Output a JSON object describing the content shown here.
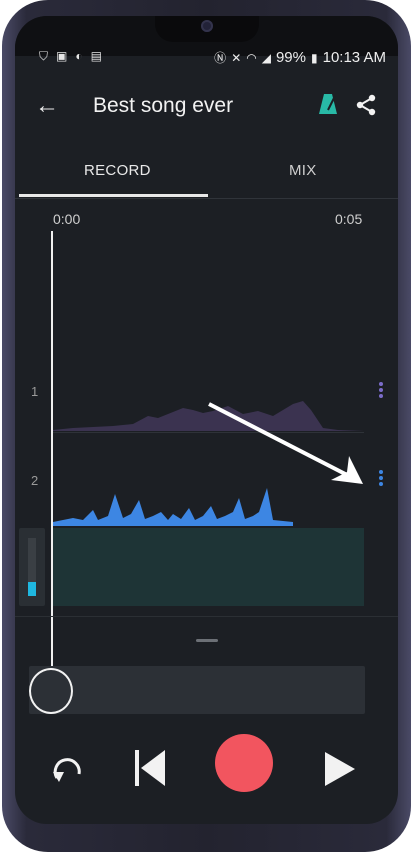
{
  "status_bar": {
    "battery": "99%",
    "time": "10:13 AM",
    "left_icons": [
      "shield-icon",
      "image-icon",
      "sync-icon",
      "file-icon"
    ],
    "right_icons": [
      "nfc-icon",
      "mute-icon",
      "wifi-icon",
      "signal-icon",
      "battery-icon"
    ]
  },
  "app_bar": {
    "title": "Best song ever",
    "back_icon": "arrow-left-icon",
    "metronome_icon": "metronome-icon",
    "share_icon": "share-icon",
    "accent": "#28b9a6"
  },
  "tabs": [
    {
      "label": "RECORD",
      "active": true
    },
    {
      "label": "MIX",
      "active": false
    }
  ],
  "timeline": {
    "start": "0:00",
    "end": "0:05"
  },
  "tracks": [
    {
      "number": "1",
      "color": "#3b3350",
      "menu_color": "#7b6cc9"
    },
    {
      "number": "2",
      "color": "#3d86e3",
      "menu_color": "#3d86e3"
    }
  ],
  "input_level": 0.25,
  "controls": {
    "undo_icon": "undo-icon",
    "rewind_icon": "skip-previous-icon",
    "record_icon": "record-icon",
    "play_icon": "play-icon",
    "record_color": "#f2555f"
  }
}
